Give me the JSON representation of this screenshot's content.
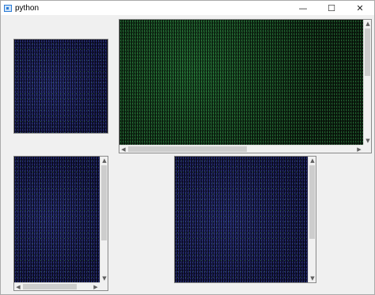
{
  "window": {
    "title": "python",
    "icon": "python-window-icon",
    "controls": {
      "minimize_glyph": "—",
      "maximize_glyph": "☐",
      "close_glyph": "✕"
    }
  },
  "scroll_glyphs": {
    "up": "▲",
    "down": "▼",
    "left": "◀",
    "right": "▶"
  },
  "panels": [
    {
      "name": "image-panel-small-top-left",
      "scheme": "blue",
      "scrollbars": "none"
    },
    {
      "name": "image-panel-large-top-right",
      "scheme": "green",
      "scrollbars": "both"
    },
    {
      "name": "image-panel-bottom-left",
      "scheme": "blue",
      "scrollbars": "both"
    },
    {
      "name": "image-panel-bottom-right",
      "scheme": "blue",
      "scrollbars": "vertical"
    }
  ],
  "colors": {
    "green_matrix": "#10301a",
    "blue_matrix": "#1a1d4e",
    "window_bg": "#f0f0f0",
    "scroll_thumb": "#cdcdcd"
  }
}
